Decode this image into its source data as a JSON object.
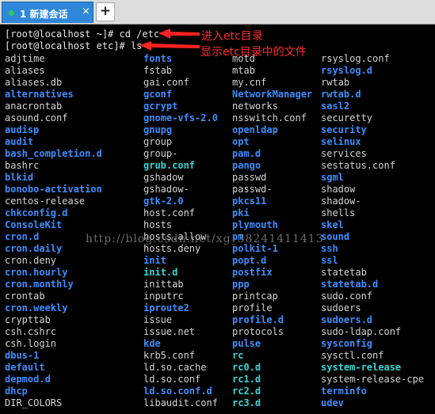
{
  "tab": {
    "title": "1 新建会话",
    "close": "×"
  },
  "new_tab": "+",
  "terminal": {
    "cmd1": "[root@localhost ~]# cd /etc",
    "cmd2": "[root@localhost etc]# ls",
    "annotation1": "进入etc目录",
    "annotation2": "显示etc目录中的文件",
    "watermark": "http://blog.csdn.net/xg_38241411413",
    "listing": [
      [
        "adjtime",
        "f",
        "fonts",
        "d",
        "motd",
        "f",
        "rsyslog.conf",
        "f"
      ],
      [
        "aliases",
        "f",
        "fstab",
        "f",
        "mtab",
        "f",
        "rsyslog.d",
        "d"
      ],
      [
        "aliases.db",
        "f",
        "gai.conf",
        "f",
        "my.cnf",
        "f",
        "rwtab",
        "f"
      ],
      [
        "alternatives",
        "d",
        "gconf",
        "d",
        "NetworkManager",
        "d",
        "rwtab.d",
        "d"
      ],
      [
        "anacrontab",
        "f",
        "gcrypt",
        "d",
        "networks",
        "f",
        "sasl2",
        "d"
      ],
      [
        "asound.conf",
        "f",
        "gnome-vfs-2.0",
        "d",
        "nsswitch.conf",
        "f",
        "securetty",
        "f"
      ],
      [
        "audisp",
        "d",
        "gnupg",
        "d",
        "openldap",
        "d",
        "security",
        "d"
      ],
      [
        "audit",
        "d",
        "group",
        "f",
        "opt",
        "d",
        "selinux",
        "d"
      ],
      [
        "bash_completion.d",
        "d",
        "group-",
        "f",
        "pam.d",
        "d",
        "services",
        "f"
      ],
      [
        "bashrc",
        "f",
        "grub.conf",
        "l",
        "pango",
        "d",
        "sestatus.conf",
        "f"
      ],
      [
        "blkid",
        "d",
        "gshadow",
        "f",
        "passwd",
        "f",
        "sgml",
        "d"
      ],
      [
        "bonobo-activation",
        "d",
        "gshadow-",
        "f",
        "passwd-",
        "f",
        "shadow",
        "f"
      ],
      [
        "centos-release",
        "f",
        "gtk-2.0",
        "d",
        "pkcs11",
        "d",
        "shadow-",
        "f"
      ],
      [
        "chkconfig.d",
        "d",
        "host.conf",
        "f",
        "pki",
        "d",
        "shells",
        "f"
      ],
      [
        "ConsoleKit",
        "d",
        "hosts",
        "f",
        "plymouth",
        "d",
        "skel",
        "d"
      ],
      [
        "cron.d",
        "d",
        "hosts.allow",
        "f",
        "pm",
        "d",
        "sound",
        "d"
      ],
      [
        "cron.daily",
        "d",
        "hosts.deny",
        "f",
        "polkit-1",
        "d",
        "ssh",
        "d"
      ],
      [
        "cron.deny",
        "f",
        "init",
        "d",
        "popt.d",
        "d",
        "ssl",
        "d"
      ],
      [
        "cron.hourly",
        "d",
        "init.d",
        "l",
        "postfix",
        "d",
        "statetab",
        "f"
      ],
      [
        "cron.monthly",
        "d",
        "inittab",
        "f",
        "ppp",
        "d",
        "statetab.d",
        "d"
      ],
      [
        "crontab",
        "f",
        "inputrc",
        "f",
        "printcap",
        "f",
        "sudo.conf",
        "f"
      ],
      [
        "cron.weekly",
        "d",
        "iproute2",
        "d",
        "profile",
        "f",
        "sudoers",
        "f"
      ],
      [
        "crypttab",
        "f",
        "issue",
        "f",
        "profile.d",
        "d",
        "sudoers.d",
        "d"
      ],
      [
        "csh.cshrc",
        "f",
        "issue.net",
        "f",
        "protocols",
        "f",
        "sudo-ldap.conf",
        "f"
      ],
      [
        "csh.login",
        "f",
        "kde",
        "d",
        "pulse",
        "d",
        "sysconfig",
        "d"
      ],
      [
        "dbus-1",
        "d",
        "krb5.conf",
        "f",
        "rc",
        "l",
        "sysctl.conf",
        "f"
      ],
      [
        "default",
        "d",
        "ld.so.cache",
        "f",
        "rc0.d",
        "l",
        "system-release",
        "l"
      ],
      [
        "depmod.d",
        "d",
        "ld.so.conf",
        "f",
        "rc1.d",
        "l",
        "system-release-cpe",
        "f"
      ],
      [
        "dhcp",
        "d",
        "ld.so.conf.d",
        "d",
        "rc2.d",
        "l",
        "terminfo",
        "d"
      ],
      [
        "DIR_COLORS",
        "f",
        "libaudit.conf",
        "f",
        "rc3.d",
        "l",
        "udev",
        "d"
      ]
    ]
  }
}
